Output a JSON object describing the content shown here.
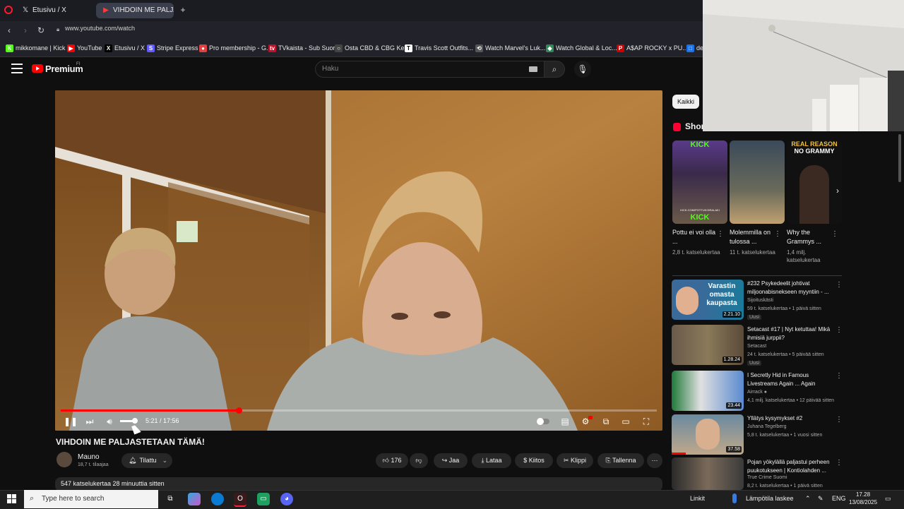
{
  "browser": {
    "tabs": [
      {
        "label": "Etusivu / X",
        "icon": "x-icon"
      },
      {
        "label": "VIHDOIN ME PALJAS",
        "icon": "youtube-icon"
      }
    ],
    "new_tab": "+",
    "url": "www.youtube.com/watch",
    "bookmarks": [
      {
        "label": "mikkomane | Kick",
        "icon": "K",
        "color": "#53fc18"
      },
      {
        "label": "YouTube",
        "icon": "▶",
        "color": "#ff0000"
      },
      {
        "label": "Etusivu / X",
        "icon": "X",
        "color": "#000000"
      },
      {
        "label": "Stripe Express",
        "icon": "S",
        "color": "#635bff"
      },
      {
        "label": "Pro membership - G...",
        "icon": "●",
        "color": "#e04040"
      },
      {
        "label": "TVkaista - Sub Suora",
        "icon": "tv",
        "color": "#c0112b"
      },
      {
        "label": "Osta CBD & CBG Ke...",
        "icon": "○",
        "color": "#444444"
      },
      {
        "label": "Travis Scott Outfits...",
        "icon": "T",
        "color": "#ffffff"
      },
      {
        "label": "Watch Marvel's Luk...",
        "icon": "⟲",
        "color": "#555555"
      },
      {
        "label": "Watch Global & Loc...",
        "icon": "◆",
        "color": "#2e8b57"
      },
      {
        "label": "A$AP ROCKY x PU...",
        "icon": "P",
        "color": "#d00000"
      },
      {
        "label": "de",
        "icon": "□",
        "color": "#1a73e8"
      }
    ]
  },
  "youtube": {
    "logo_text": "Premium",
    "logo_region": "FI",
    "search_placeholder": "Haku",
    "video": {
      "current_time": "5:21 / 17:56",
      "progress": 0.298,
      "volume": 0.7,
      "title": "VIHDOIN ME PALJASTETAAN TÄMÄ!"
    },
    "channel": {
      "name": "Mauno",
      "subscribers": "18,7 t. tilaajaa",
      "subscribe_label": "Tilattu"
    },
    "actions": {
      "likes": "176",
      "share": "Jaa",
      "download": "Lataa",
      "thanks": "Kiitos",
      "clip": "Klippi",
      "save": "Tallenna",
      "more": "⋯"
    },
    "description_meta": "547 katselukertaa  28 minuuttia sitten",
    "filter_chip": "Kaikki",
    "shorts_heading": "Shor",
    "shorts": [
      {
        "title": "Pottu ei voi olla ...",
        "views": "2,8 t. katselukertaa",
        "overlay_top": "KICK",
        "overlay_bottom": "KICK",
        "overlay_url": "KICK.COM/POTTUKOIRALAKI"
      },
      {
        "title": "Molemmilla on tulossa ...",
        "views": "11 t. katselukertaa",
        "overlay_top": "",
        "overlay_bottom": "",
        "overlay_url": ""
      },
      {
        "title": "Why the Grammys ...",
        "views": "1,4 milj. katselukertaa",
        "overlay_top": "REAL REASON",
        "overlay_bottom": "NO GRAMMY",
        "overlay_url": ""
      }
    ],
    "recommendations": [
      {
        "title": "#232 Psykedeelit johtivat miljoonabisnekseen myyntiin - ...",
        "channel": "Sijoituskästi",
        "meta": "59 t. katselukertaa • 1 päivä sitten",
        "badge": "Uusi",
        "duration": "2.21.10",
        "thumb_text": "Varastin omasta kaupasta"
      },
      {
        "title": "Setacast #17 | Nyt ketuttaa! Mikä ihmisiä jurppii?",
        "channel": "Setacast",
        "meta": "24 t. katselukertaa • 5 päivää sitten",
        "badge": "Uusi",
        "duration": "1.28.24",
        "thumb_text": ""
      },
      {
        "title": "I Secretly Hid in Famous Livestreams Again ... Again",
        "channel": "Airrack",
        "meta": "4,1 milj. katselukertaa • 12 päivää sitten",
        "badge": "",
        "duration": "23.44",
        "thumb_text": ""
      },
      {
        "title": "Yllätys kysymykset #2",
        "channel": "Juhana Tegelberg",
        "meta": "5,8 t. katselukertaa • 1 vuosi sitten",
        "badge": "",
        "duration": "37.58",
        "thumb_text": ""
      },
      {
        "title": "Pojan yökylällä paljastui perheen puukotukseen | Kontiolahden ...",
        "channel": "True Crime Suomi",
        "meta": "8,2 t. katselukertaa • 1 päivä sitten",
        "badge": "",
        "duration": "",
        "thumb_text": ""
      }
    ]
  },
  "taskbar": {
    "search_placeholder": "Type here to search",
    "links": "Linkit",
    "weather": "Lämpötila laskee",
    "language": "ENG",
    "time": "17.28",
    "date": "13/08/2025"
  }
}
